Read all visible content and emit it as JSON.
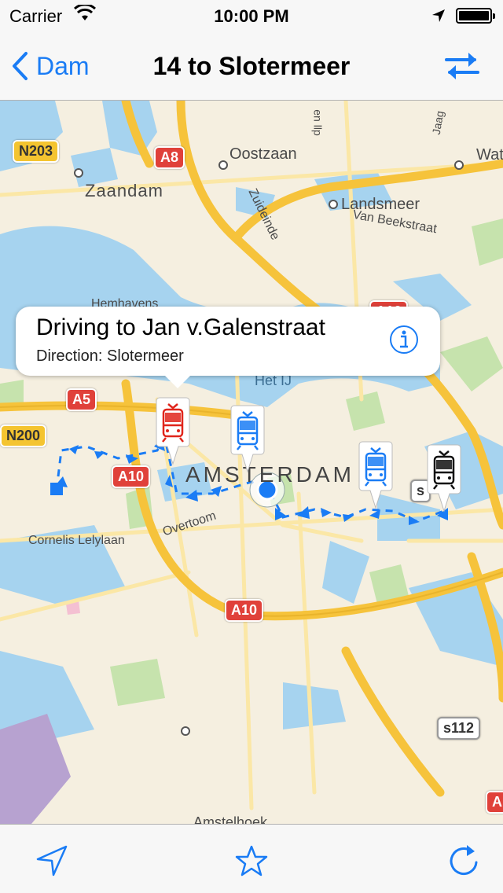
{
  "status_bar": {
    "carrier": "Carrier",
    "time": "10:00 PM",
    "battery_level": 1.0
  },
  "nav": {
    "back_label": "Dam",
    "title": "14 to Slotermeer"
  },
  "map": {
    "labels": {
      "zaandam": "Zaandam",
      "oostzaan": "Oostzaan",
      "landsmeer": "Landsmeer",
      "van_beekstraat": "Van Beekstraat",
      "zuideinde": "Zuideinde",
      "hemhavens": "Hemhavens",
      "het_ij": "Het IJ",
      "amsterdam": "AMSTERDAM",
      "overtoom": "Overtoom",
      "cornelis_lelylaan": "Cornelis Lelylaan",
      "amstelhoek": "Amstelhoek",
      "water": "Water",
      "jaag": "Jaag",
      "en_lip": "en llp"
    },
    "shields": {
      "n203": "N203",
      "a8": "A8",
      "a5": "A5",
      "n200": "N200",
      "a10_west": "A10",
      "a10_south": "A10",
      "a10_ne": "A10",
      "s116": "s116",
      "s112": "s112",
      "s_small": "s",
      "a_bottom": "A"
    }
  },
  "callout": {
    "title": "Driving to Jan v.Galenstraat",
    "subtitle": "Direction: Slotermeer"
  },
  "tram_pins": [
    {
      "color": "#e0251b",
      "state": "selected"
    },
    {
      "color": "#1a7cf5",
      "state": "normal"
    },
    {
      "color": "#1a7cf5",
      "state": "normal"
    },
    {
      "color": "#111111",
      "state": "normal"
    }
  ],
  "colors": {
    "accent": "#1a7cf5",
    "water": "#a6d3ef",
    "highway": "#f6c33b",
    "park": "#c6e3ad"
  },
  "toolbar": {
    "icons": [
      "location-arrow-icon",
      "star-icon",
      "refresh-icon"
    ]
  }
}
